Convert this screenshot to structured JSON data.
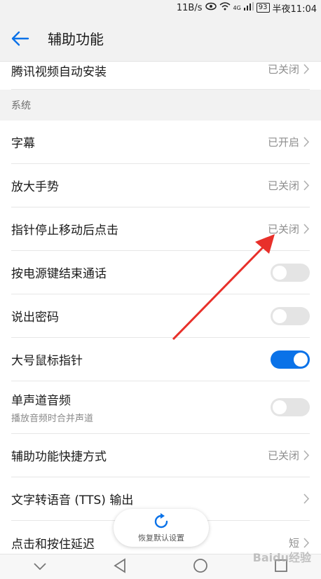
{
  "status_bar": {
    "speed": "11B/s",
    "network": "4G",
    "battery": "93",
    "time": "半夜11:04"
  },
  "header": {
    "title": "辅助功能"
  },
  "rows_top": [
    {
      "label": "腾讯视频自动安装",
      "value": "已关闭"
    }
  ],
  "section_system": "系统",
  "rows": [
    {
      "label": "字幕",
      "value": "已开启"
    },
    {
      "label": "放大手势",
      "value": "已关闭"
    },
    {
      "label": "指针停止移动后点击",
      "value": "已关闭"
    },
    {
      "label": "按电源键结束通话",
      "toggle": "off"
    },
    {
      "label": "说出密码",
      "toggle": "off"
    },
    {
      "label": "大号鼠标指针",
      "toggle": "on"
    },
    {
      "label": "单声道音频",
      "sublabel": "播放音频时合并声道",
      "toggle": "off"
    },
    {
      "label": "辅助功能快捷方式",
      "value": "已关闭"
    },
    {
      "label": "文字转语音 (TTS) 输出"
    },
    {
      "label": "点击和按住延迟",
      "value": "短"
    }
  ],
  "restore_button": {
    "label": "恢复默认设置"
  },
  "colors": {
    "accent": "#0a72e8",
    "annotation_arrow": "#e8302a"
  },
  "watermark": "Baidu经验"
}
